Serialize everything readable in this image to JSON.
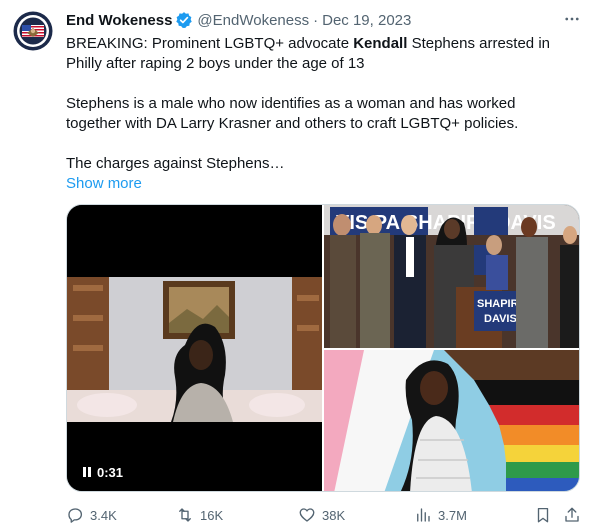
{
  "author": {
    "name": "End Wokeness",
    "handle": "@EndWokeness",
    "separator": "·",
    "date": "Dec 19, 2023",
    "verified_color": "#1d9bf0",
    "avatar_text_top": "END WOKENESS",
    "avatar_text_bottom": "SINCE 2021"
  },
  "tweet": {
    "line1_pre": "BREAKING: Prominent LGBTQ+ advocate ",
    "line1_bold": "Kendall",
    "line1_post": " Stephens arrested in Philly after raping 2 boys under the age of 13",
    "paragraph2": "Stephens is a male who now identifies as a woman and has worked together with DA Larry Krasner and others to craft LGBTQ+ policies.",
    "paragraph3": "The charges against Stephens…",
    "show_more": "Show more",
    "link_color": "#1d9bf0"
  },
  "media": {
    "video_time": "0:31",
    "sign_text_1": "SHAPIRO",
    "sign_text_2": "DAVIS",
    "banner_text": "VIS PA SHAPIRODAVIS"
  },
  "actions": {
    "replies": "3.4K",
    "reposts": "16K",
    "likes": "38K",
    "views": "3.7M"
  }
}
